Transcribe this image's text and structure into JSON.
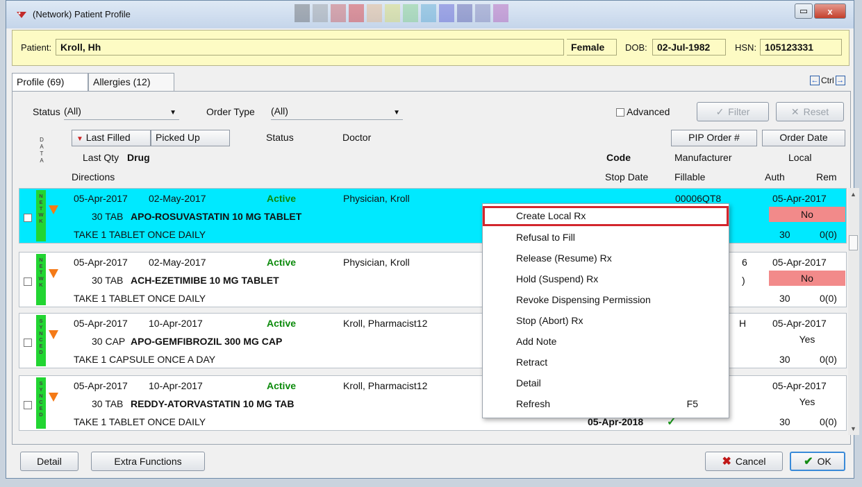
{
  "window": {
    "title": "(Network) Patient Profile",
    "close_label": "x"
  },
  "patient": {
    "label": "Patient:",
    "name": "Kroll, Hh",
    "sex": "Female",
    "dob_label": "DOB:",
    "dob": "02-Jul-1982",
    "hsn_label": "HSN:",
    "hsn": "105123331"
  },
  "tabs": [
    {
      "label": "Profile (69)"
    },
    {
      "label": "Allergies (12)"
    }
  ],
  "nav": {
    "ctrl_label": "Ctrl"
  },
  "filters": {
    "status_label": "Status",
    "status_value": "(All)",
    "order_type_label": "Order Type",
    "order_type_value": "(All)",
    "advanced_label": "Advanced",
    "filter_label": "Filter",
    "reset_label": "Reset"
  },
  "columns": {
    "data_label": "DATA",
    "last_filled": "Last Filled",
    "picked_up": "Picked Up",
    "status": "Status",
    "doctor": "Doctor",
    "pip_order": "PIP Order #",
    "order_date": "Order Date",
    "last_qty": "Last Qty",
    "drug": "Drug",
    "code": "Code",
    "manufacturer": "Manufacturer",
    "local": "Local",
    "directions": "Directions",
    "stop_date": "Stop Date",
    "fillable": "Fillable",
    "auth": "Auth",
    "rem": "Rem"
  },
  "rows": [
    {
      "tag": "NETWK",
      "last_filled": "05-Apr-2017",
      "picked_up": "02-May-2017",
      "status": "Active",
      "doctor": "Physician, Kroll",
      "qty": "30 TAB",
      "drug": "APO-ROSUVASTATIN 10 MG TABLET",
      "directions": "TAKE 1 TABLET ONCE DAILY",
      "pip": "00006QT8",
      "order_date": "05-Apr-2017",
      "local": "No",
      "auth": "30",
      "rem": "0(0)"
    },
    {
      "tag": "NETWK",
      "last_filled": "05-Apr-2017",
      "picked_up": "02-May-2017",
      "status": "Active",
      "doctor": "Physician, Kroll",
      "qty": "30 TAB",
      "drug": "ACH-EZETIMIBE 10 MG TABLET",
      "directions": "TAKE 1 TABLET ONCE DAILY",
      "pip": "6",
      "pip2": ")",
      "order_date": "05-Apr-2017",
      "local": "No",
      "auth": "30",
      "rem": "0(0)"
    },
    {
      "tag": "SYNCED",
      "last_filled": "05-Apr-2017",
      "picked_up": "10-Apr-2017",
      "status": "Active",
      "doctor": "Kroll, Pharmacist12",
      "qty": "30 CAP",
      "drug": "APO-GEMFIBROZIL 300 MG CAP",
      "directions": "TAKE 1 CAPSULE ONCE A DAY",
      "pip": "H",
      "order_date": "05-Apr-2017",
      "local": "Yes",
      "auth": "30",
      "rem": "0(0)"
    },
    {
      "tag": "SYNCED",
      "last_filled": "05-Apr-2017",
      "picked_up": "10-Apr-2017",
      "status": "Active",
      "doctor": "Kroll, Pharmacist12",
      "qty": "30 TAB",
      "drug": "REDDY-ATORVASTATIN 10 MG TAB",
      "directions": "TAKE 1 TABLET ONCE DAILY",
      "stop_date": "05-Apr-2018",
      "order_date": "05-Apr-2017",
      "local": "Yes",
      "auth": "30",
      "rem": "0(0)"
    }
  ],
  "context_menu": [
    {
      "label": "Create Local Rx",
      "shortcut": ""
    },
    {
      "label": "Refusal to Fill",
      "shortcut": ""
    },
    {
      "label": "Release (Resume) Rx",
      "shortcut": ""
    },
    {
      "label": "Hold (Suspend) Rx",
      "shortcut": ""
    },
    {
      "label": "Revoke Dispensing Permission",
      "shortcut": ""
    },
    {
      "label": "Stop (Abort) Rx",
      "shortcut": ""
    },
    {
      "label": "Add Note",
      "shortcut": ""
    },
    {
      "label": "Retract",
      "shortcut": ""
    },
    {
      "label": "Detail",
      "shortcut": ""
    },
    {
      "label": "Refresh",
      "shortcut": "F5"
    }
  ],
  "footer": {
    "detail_label": "Detail",
    "extra_label": "Extra Functions",
    "cancel_label": "Cancel",
    "ok_label": "OK"
  },
  "colors": {
    "selected_row": "#00e9ff",
    "active_status": "#0b8a0b",
    "tag_green": "#22d532",
    "no_cell": "#f28a8a",
    "highlight_border": "#d3262d",
    "patient_bar": "#fdfbc4"
  }
}
